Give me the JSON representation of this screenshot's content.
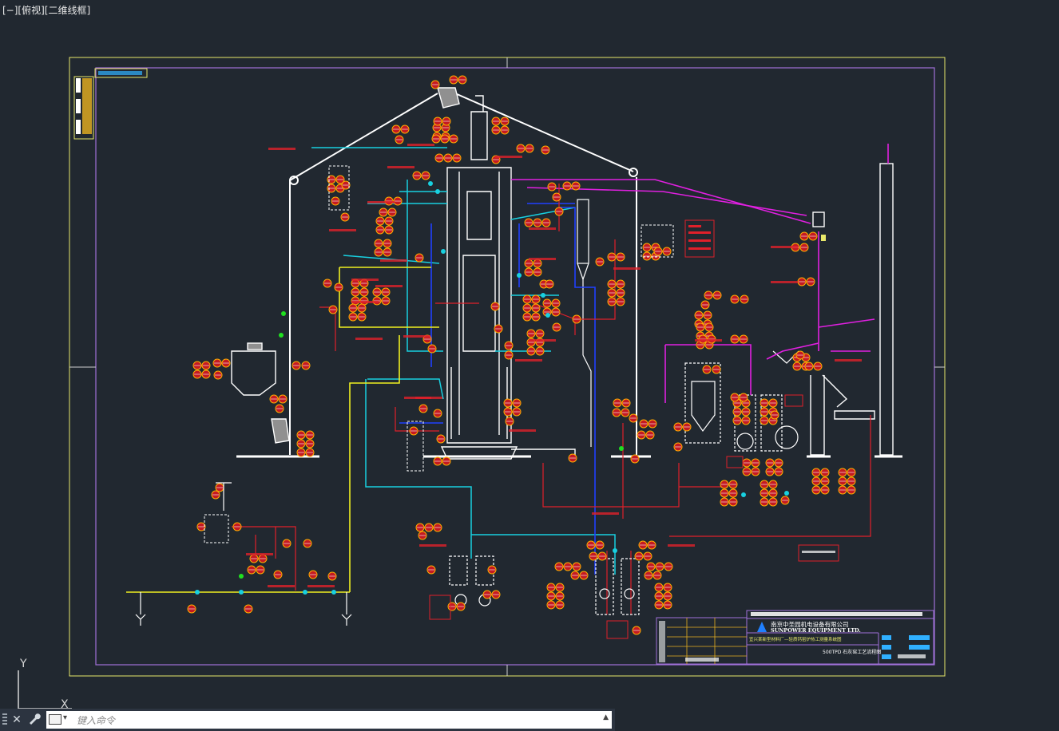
{
  "viewport": {
    "label": "[−][俯视][二维线框]"
  },
  "title_block": {
    "company_cn": "南京中圣园机电设备有限公司",
    "company_en": "SUNPOWER EQUIPMENT LTD.",
    "drawing_title": "宜兴某新型材料厂—轻质钙窑炉热工测量系统图",
    "drawing_subtitle": "500TPD 石灰窑工艺流程图"
  },
  "ucs": {
    "y_label": "Y",
    "x_label": "X"
  },
  "command_line": {
    "placeholder": "键入命令",
    "close_icon": "close-icon",
    "customize_icon": "wrench-icon",
    "history_icon": "triangle-up-icon"
  },
  "colors": {
    "background": "#212830",
    "border_outer": "#e8e86a",
    "border_inner": "#a070d8",
    "structure": "#ffffff",
    "instrument_red": "#e0202a",
    "pipe_cyan": "#18d0e0",
    "pipe_magenta": "#e020e0",
    "pipe_blue": "#2040ff",
    "pipe_yellow": "#f0f020"
  }
}
